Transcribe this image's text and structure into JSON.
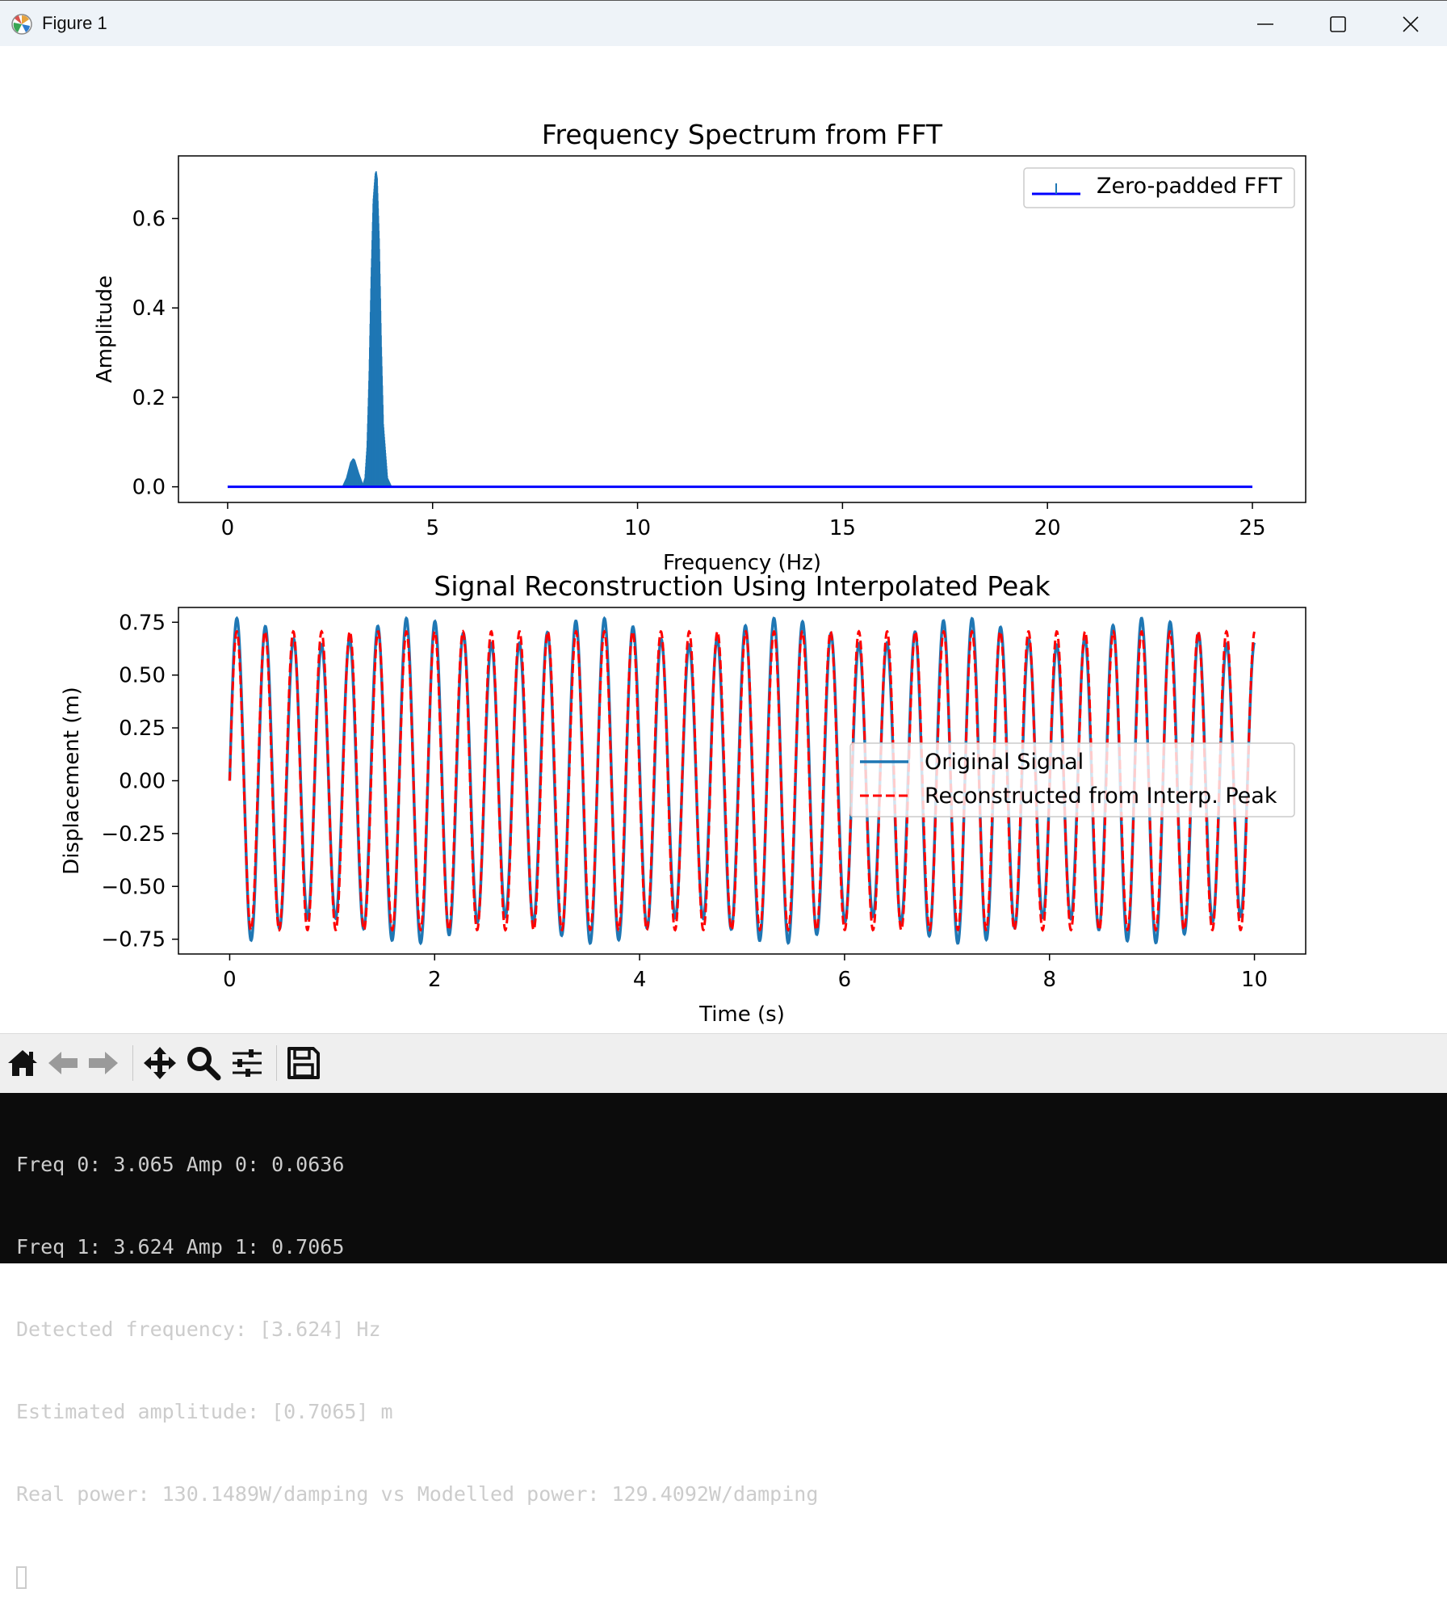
{
  "window": {
    "title": "Figure 1",
    "icons": {
      "app": "matplotlib-icon",
      "minimize": "minimize-icon",
      "maximize": "maximize-icon",
      "close": "close-icon"
    }
  },
  "chart_data": [
    {
      "type": "area",
      "title": "Frequency Spectrum from FFT",
      "xlabel": "Frequency (Hz)",
      "ylabel": "Amplitude",
      "xlim": [
        -1.2,
        26.3
      ],
      "ylim": [
        -0.035,
        0.74
      ],
      "xticks": [
        "0",
        "5",
        "10",
        "15",
        "20",
        "25"
      ],
      "yticks": [
        "0.0",
        "0.2",
        "0.4",
        "0.6"
      ],
      "legend": {
        "placement": "upper right",
        "entries": [
          "Zero-padded FFT"
        ]
      },
      "series": [
        {
          "name": "Zero-padded FFT",
          "style": "stem",
          "color": "#1f77b4",
          "baseline_color": "#0000ff",
          "x": [
            0,
            2.8,
            2.9,
            3.0,
            3.065,
            3.1,
            3.2,
            3.3,
            3.35,
            3.4,
            3.45,
            3.5,
            3.55,
            3.6,
            3.624,
            3.65,
            3.7,
            3.75,
            3.8,
            3.9,
            4.0,
            25
          ],
          "y": [
            0,
            0,
            0.02,
            0.055,
            0.0636,
            0.06,
            0.03,
            0.005,
            0.02,
            0.09,
            0.25,
            0.47,
            0.64,
            0.7,
            0.7065,
            0.69,
            0.55,
            0.32,
            0.14,
            0.02,
            0,
            0
          ]
        }
      ]
    },
    {
      "type": "line",
      "title": "Signal Reconstruction Using Interpolated Peak",
      "xlabel": "Time (s)",
      "ylabel": "Displacement (m)",
      "xlim": [
        -0.5,
        10.5
      ],
      "ylim": [
        -0.82,
        0.82
      ],
      "xticks": [
        "0",
        "2",
        "4",
        "6",
        "8",
        "10"
      ],
      "yticks": [
        "0.75",
        "0.50",
        "0.25",
        "0.00",
        "−0.25",
        "−0.50",
        "−0.75"
      ],
      "legend": {
        "placement": "center right",
        "entries": [
          "Original Signal",
          "Reconstructed from Interp. Peak"
        ]
      },
      "series": [
        {
          "name": "Original Signal",
          "color": "#1f77b4",
          "style": "solid",
          "components": [
            {
              "freq": 3.624,
              "amp": 0.7065
            },
            {
              "freq": 3.065,
              "amp": 0.0636
            }
          ],
          "t_range": [
            0,
            10
          ]
        },
        {
          "name": "Reconstructed from Interp. Peak",
          "color": "#ff0000",
          "style": "dashed",
          "components": [
            {
              "freq": 3.624,
              "amp": 0.7065
            }
          ],
          "t_range": [
            0,
            10
          ]
        }
      ]
    }
  ],
  "toolbar": {
    "items": [
      {
        "name": "home-icon",
        "label": "Home"
      },
      {
        "name": "back-arrow-icon",
        "label": "Back"
      },
      {
        "name": "forward-arrow-icon",
        "label": "Forward"
      },
      {
        "name": "pan-icon",
        "label": "Pan"
      },
      {
        "name": "zoom-icon",
        "label": "Zoom"
      },
      {
        "name": "configure-subplots-icon",
        "label": "Subplots"
      },
      {
        "name": "save-icon",
        "label": "Save"
      }
    ]
  },
  "console": {
    "lines": [
      "Freq 0: 3.065 Amp 0: 0.0636",
      "Freq 1: 3.624 Amp 1: 0.7065",
      "Detected frequency: [3.624] Hz",
      "Estimated amplitude: [0.7065] m",
      "Real power: 130.1489W/damping vs Modelled power: 129.4092W/damping"
    ]
  }
}
